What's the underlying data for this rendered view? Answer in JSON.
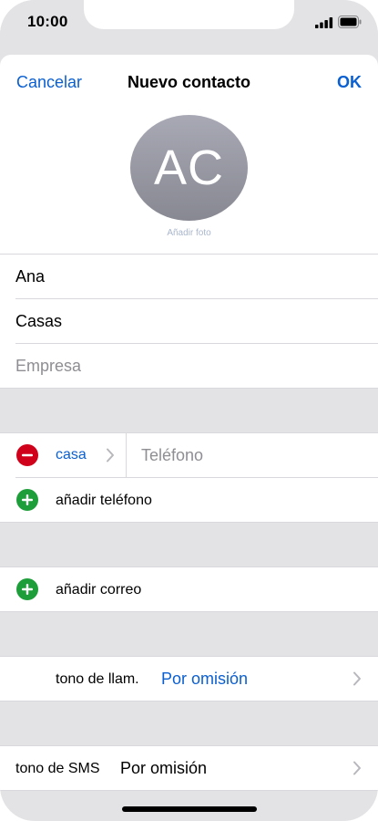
{
  "status": {
    "time": "10:00"
  },
  "nav": {
    "cancel": "Cancelar",
    "title": "Nuevo contacto",
    "ok": "OK"
  },
  "avatar": {
    "initials": "AC",
    "add_photo": "Añadir foto"
  },
  "fields": {
    "first_name": "Ana",
    "last_name": "Casas",
    "company_placeholder": "Empresa"
  },
  "phone": {
    "label": "casa",
    "placeholder": "Teléfono",
    "add": "añadir teléfono"
  },
  "email": {
    "add": "añadir correo"
  },
  "ringtone": {
    "label": "tono de llam.",
    "value": "Por omisión"
  },
  "sms_tone": {
    "label": "tono de SMS",
    "value": "Por omisión"
  },
  "colors": {
    "accent": "#0a5fd1",
    "remove": "#d0021b",
    "add": "#1e9e3a",
    "placeholder": "#8e8e93"
  },
  "icons": {
    "remove": "minus-circle-icon",
    "add": "plus-circle-icon",
    "disclosure": "chevron-right-icon"
  }
}
